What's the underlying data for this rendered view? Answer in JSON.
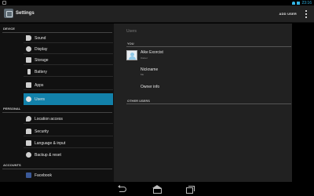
{
  "statusbar": {
    "time": "23:16",
    "colors": {
      "accent": "#33b5e5"
    }
  },
  "actionbar": {
    "title": "Settings",
    "add_user": "ADD USER",
    "partial_header": "-"
  },
  "sidebar": {
    "sections": {
      "device": "DEVICE",
      "personal": "PERSONAL",
      "accounts": "ACCOUNTS"
    },
    "items": [
      {
        "label": "Sound",
        "icon": "volume-icon"
      },
      {
        "label": "Display",
        "icon": "display-icon"
      },
      {
        "label": "Storage",
        "icon": "storage-icon"
      },
      {
        "label": "Battery",
        "icon": "battery-icon"
      },
      {
        "label": "Apps",
        "icon": "apps-icon"
      },
      {
        "label": "Users",
        "icon": "users-icon",
        "selected": true
      },
      {
        "label": "Location access",
        "icon": "location-icon"
      },
      {
        "label": "Security",
        "icon": "lock-icon"
      },
      {
        "label": "Language & input",
        "icon": "language-icon"
      },
      {
        "label": "Backup & reset",
        "icon": "backup-icon"
      },
      {
        "label": "Facebook",
        "icon": "facebook-icon"
      }
    ],
    "selected_color": "#1281aa"
  },
  "main": {
    "title": "Users",
    "you_header": "YOU",
    "user": {
      "name": "Aike Exorcist",
      "role": "Owner"
    },
    "nickname": {
      "label": "Nickname",
      "value": "Me"
    },
    "owner_info": "Owner info",
    "other_users_header": "OTHER USERS"
  }
}
